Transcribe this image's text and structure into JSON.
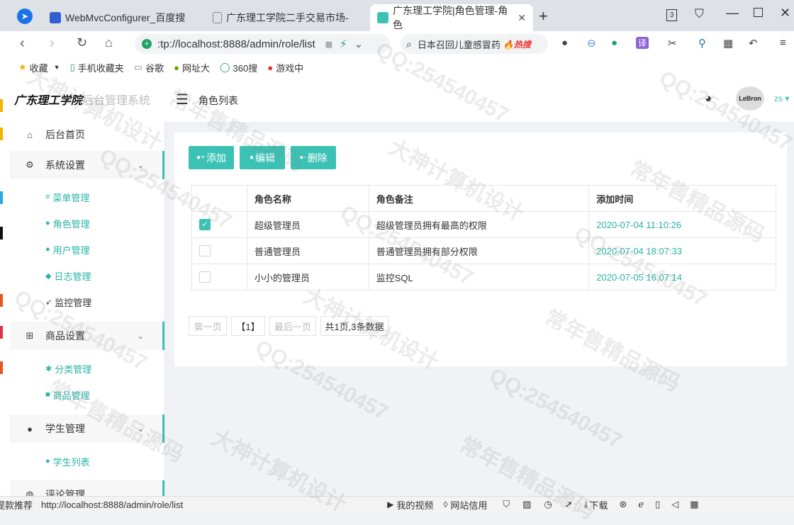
{
  "browser": {
    "tabs": [
      {
        "title": "WebMvcConfigurer_百度搜"
      },
      {
        "title": "广东理工学院二手交易市场-"
      },
      {
        "title": "广东理工学院|角色管理-角色"
      }
    ],
    "tab_count": "3",
    "address": ":tp://localhost:8888/admin/role/list",
    "search_text": "日本召回儿童感冒药",
    "search_badge": "热搜",
    "bookmarks": [
      {
        "label": "收藏",
        "icon": "star-icon"
      },
      {
        "label": "手机收藏夹",
        "icon": "phone-icon"
      },
      {
        "label": "谷歌",
        "icon": "page-icon"
      },
      {
        "label": "网址大",
        "icon": "globe-icon"
      },
      {
        "label": "360搜",
        "icon": "search-icon"
      },
      {
        "label": "游戏中",
        "icon": "game-icon"
      }
    ]
  },
  "app": {
    "logo_bold": "广东理工学院",
    "logo_rest": "后台管理系统",
    "header_title": "角色列表",
    "user": "zs",
    "avatar_text": "LeBron"
  },
  "sidebar": {
    "home": "后台首页",
    "system": "系统设置",
    "system_items": [
      "菜单管理",
      "角色管理",
      "用户管理",
      "日志管理",
      "监控管理"
    ],
    "goods": "商品设置",
    "goods_items": [
      "分类管理",
      "商品管理"
    ],
    "student": "学生管理",
    "student_items": [
      "学生列表"
    ],
    "comment": "评论管理"
  },
  "toolbar": {
    "add": "添加",
    "edit": "编辑",
    "delete": "删除"
  },
  "table": {
    "headers": [
      "角色名称",
      "角色备注",
      "添加时间"
    ],
    "rows": [
      {
        "name": "超级管理员",
        "remark": "超级管理员拥有最高的权限",
        "time": "2020-07-04 11:10:26",
        "checked": true
      },
      {
        "name": "普通管理员",
        "remark": "普通管理员拥有部分权限",
        "time": "2020-07-04 18:07:33",
        "checked": false
      },
      {
        "name": "小小的管理员",
        "remark": "监控SQL",
        "time": "2020-07-05 16:07:14",
        "checked": false
      }
    ]
  },
  "pagination": {
    "first": "第一页",
    "current": "【1】",
    "last": "最后一页",
    "info": "共1页,3条数据"
  },
  "statusbar": {
    "left": "提款推荐",
    "url": "http://localhost:8888/admin/role/list",
    "video": "我的视频",
    "credit": "网站信用",
    "download": "下载"
  },
  "watermark": [
    "QQ:254540457",
    "大神计算机设计",
    "常年售精品源码"
  ],
  "colors": {
    "accent": "#3cc2b5",
    "time_text": "#2ab3a6"
  }
}
